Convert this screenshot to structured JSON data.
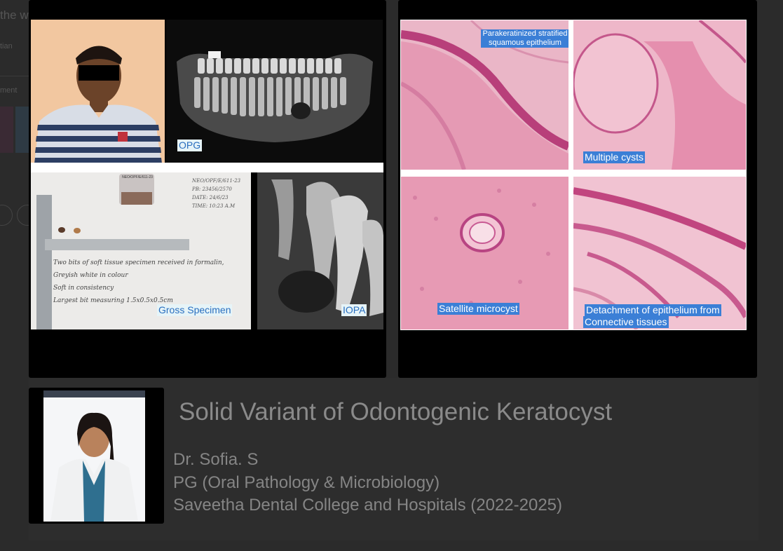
{
  "background_page": {
    "title_fragment": "the w",
    "author_fragment": "tian",
    "comment_fragment": "ment"
  },
  "slide_left": {
    "labels": {
      "opg": "OPG",
      "gross": "Gross Specimen",
      "iopa": "IOPA"
    },
    "specimen_note_lines": [
      "Two bits of soft tissue specimen received in formalin,",
      "Greyish white in colour",
      "Soft in consistency",
      "Largest bit measuring 1.5x0.5x0.5cm"
    ],
    "jar_label_lines": [
      "NEO/OPF/E/611-23",
      "PB: 23456/2570",
      "DATE: 24/6/23",
      "TIME: 10:23 A.M"
    ]
  },
  "slide_right": {
    "labels": {
      "h1": "Parakeratinized stratified squamous epithelium",
      "h2": "Multiple cysts",
      "h3": "Satellite microcyst",
      "h4_line1": "Detachment of epithelium from",
      "h4_line2": "Connective tissues"
    }
  },
  "presentation": {
    "title": "Solid Variant of Odontogenic Keratocyst",
    "presenter_name": "Dr. Sofia. S",
    "presenter_role": "PG (Oral Pathology & Microbiology)",
    "presenter_institution": "Saveetha Dental College and Hospitals (2022-2025)"
  }
}
